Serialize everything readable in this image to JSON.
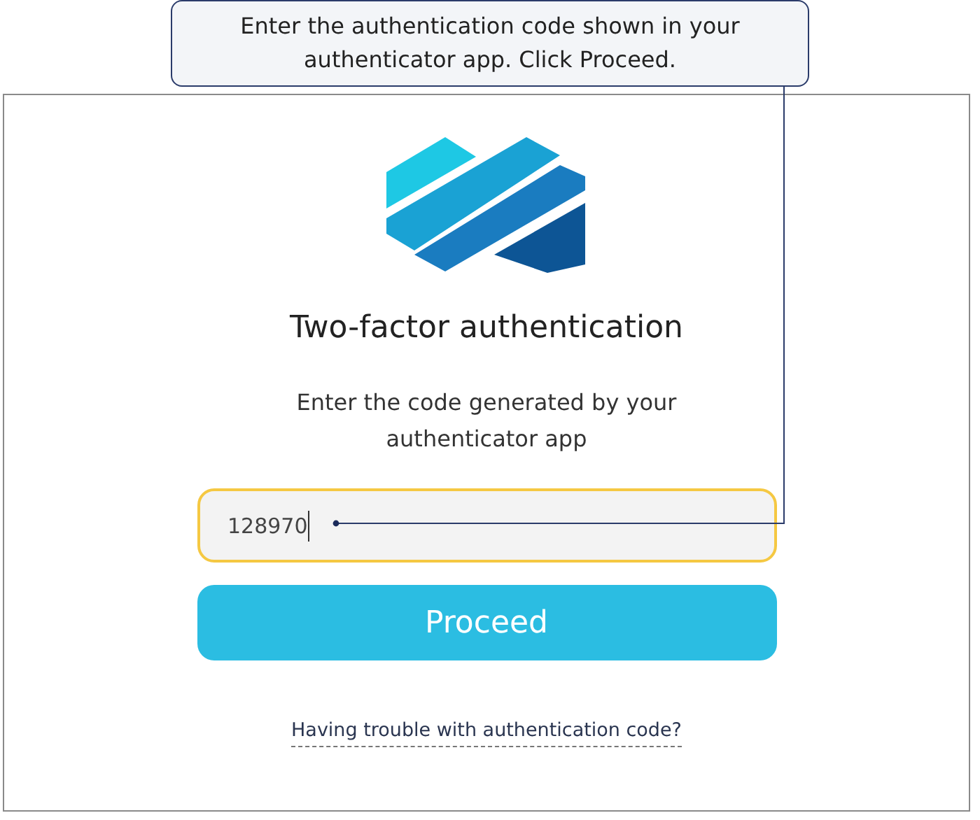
{
  "callout": {
    "text": "Enter the authentication code shown in your authenticator app. Click Proceed."
  },
  "login": {
    "title": "Two-factor authentication",
    "subtitle": "Enter the code generated by your authenticator app",
    "code_field": {
      "value": "128970",
      "focused": true
    },
    "button": "Proceed",
    "help_link": "Having trouble with authentication code?"
  }
}
